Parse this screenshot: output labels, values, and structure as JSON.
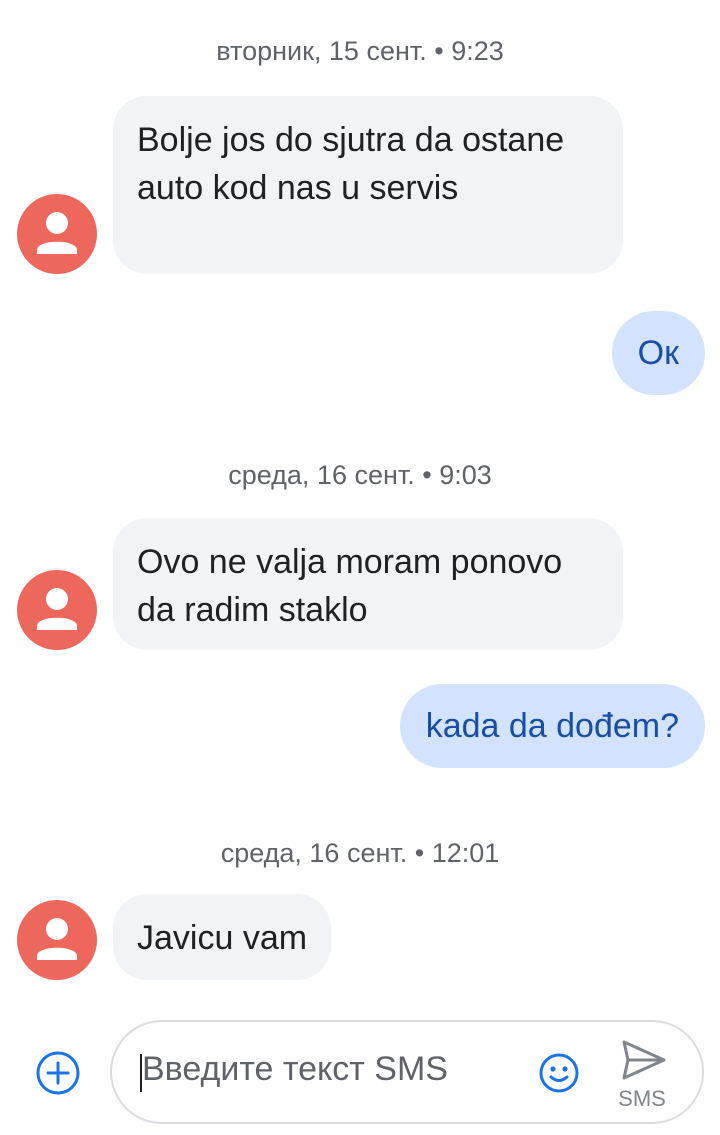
{
  "conversation": {
    "groups": [
      {
        "timestamp": "вторник, 15 сент. • 9:23",
        "incoming": "Bolje jos do sjutra da ostane auto kod nas u servis",
        "outgoing": "Ок"
      },
      {
        "timestamp": "среда, 16 сент. • 9:03",
        "incoming": "Ovo ne valja moram ponovo da radim staklo",
        "outgoing": "kada da dođem?"
      },
      {
        "timestamp": "среда, 16 сент. • 12:01",
        "incoming": "Javicu vam"
      }
    ]
  },
  "composer": {
    "placeholder": "Введите текст SMS",
    "send_label": "SMS",
    "add_icon": "add-circle-icon",
    "emoji_icon": "emoji-icon",
    "send_icon": "send-icon"
  },
  "colors": {
    "incoming_bubble": "#f1f3f4",
    "outgoing_bubble": "#d3e3fd",
    "outgoing_text": "#174ea6",
    "avatar": "#ee675c",
    "accent": "#1a73e8"
  }
}
